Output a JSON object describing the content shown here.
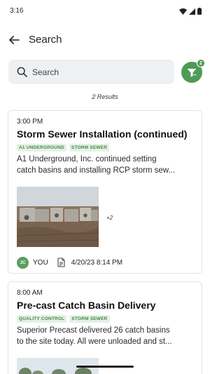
{
  "status_bar": {
    "time": "3:16"
  },
  "header": {
    "title": "Search"
  },
  "search": {
    "placeholder": "Search",
    "value": ""
  },
  "filter": {
    "badge_count": "2"
  },
  "results": {
    "count_label": "2 Results"
  },
  "cards": [
    {
      "time": "3:00 PM",
      "title": "Storm Sewer Installation (continued)",
      "tags": [
        "A1 UNDERGROUND",
        "STORM SEWER"
      ],
      "desc_line1": "A1 Underground, Inc. continued setting",
      "desc_line2": "catch basins and installing RCP storm sew...",
      "more_photos": "+2",
      "author_initials": "JC",
      "author_label": "YOU",
      "date": "4/20/23 8:14 PM"
    },
    {
      "time": "8:00 AM",
      "title": "Pre-cast Catch Basin Delivery",
      "tags": [
        "QUALITY CONTROL",
        "STORM SEWER"
      ],
      "desc_line1": "Superior Precast delivered 26 catch basins",
      "desc_line2": "to the site today. All were unloaded and st..."
    }
  ],
  "colors": {
    "accent": "#4f9a57",
    "tag_bg": "#e6f1e6",
    "tag_text": "#3e8a45",
    "search_bg": "#eef0f2"
  },
  "icons": {
    "back": "arrow-left-icon",
    "search": "magnifier-icon",
    "filter": "filter-funnel-icon",
    "document": "document-icon"
  }
}
